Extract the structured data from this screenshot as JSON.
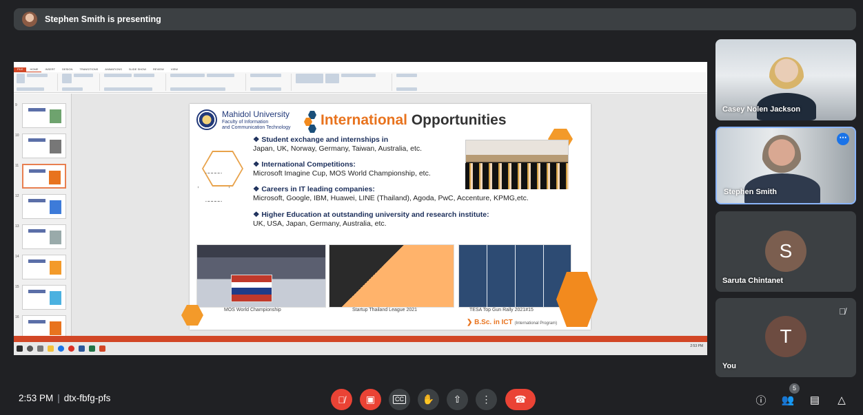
{
  "banner": {
    "presenter_text": "Stephen Smith is presenting"
  },
  "slide": {
    "org_name": "Mahidol University",
    "faculty_line1": "Faculty of Information",
    "faculty_line2": "and Communication Technology",
    "title_highlight": "International",
    "title_rest": " Opportunities",
    "bullets": [
      {
        "heading": "Student exchange and internships in",
        "detail": "Japan, UK, Norway, Germany, Taiwan, Australia, etc."
      },
      {
        "heading": "International Competitions:",
        "detail": "Microsoft Imagine Cup, MOS World Championship, etc."
      },
      {
        "heading": "Careers in IT leading companies:",
        "detail": "Microsoft, Google, IBM, Huawei, LINE (Thailand), Agoda, PwC, Accenture, KPMG,etc."
      },
      {
        "heading": "Higher Education at outstanding university and research institute:",
        "detail": "UK, USA, Japan, Germany, Australia, etc."
      }
    ],
    "captions": [
      "MOS World Championship",
      "Startup Thailand League 2021",
      "TESA Top Gun Rally 2021#15"
    ],
    "program_label": "B.Sc. in ICT",
    "program_sub": "(International Program)"
  },
  "powerpoint": {
    "menu": [
      "FILE",
      "HOME",
      "INSERT",
      "DESIGN",
      "TRANSITIONS",
      "ANIMATIONS",
      "SLIDE SHOW",
      "REVIEW",
      "VIEW"
    ],
    "thumb_numbers": [
      "9",
      "10",
      "11",
      "12",
      "13",
      "14",
      "15",
      "16"
    ],
    "clock_time": "2:53 PM"
  },
  "participants": [
    {
      "name": "Casey Nolen Jackson",
      "kind": "video"
    },
    {
      "name": "Stephen Smith",
      "kind": "video",
      "active": true
    },
    {
      "name": "Saruta Chintanet",
      "initial": "S",
      "avatar_color": "#7b5e4f"
    },
    {
      "name": "You",
      "initial": "T",
      "avatar_color": "#6d4c41",
      "muted": true
    }
  ],
  "footer": {
    "time": "2:53 PM",
    "meeting_code": "dtx-fbfg-pfs",
    "people_count": "5"
  },
  "colors": {
    "end_call": "#ea4335",
    "active_border": "#8ab4f8",
    "accent": "#1a73e8"
  }
}
